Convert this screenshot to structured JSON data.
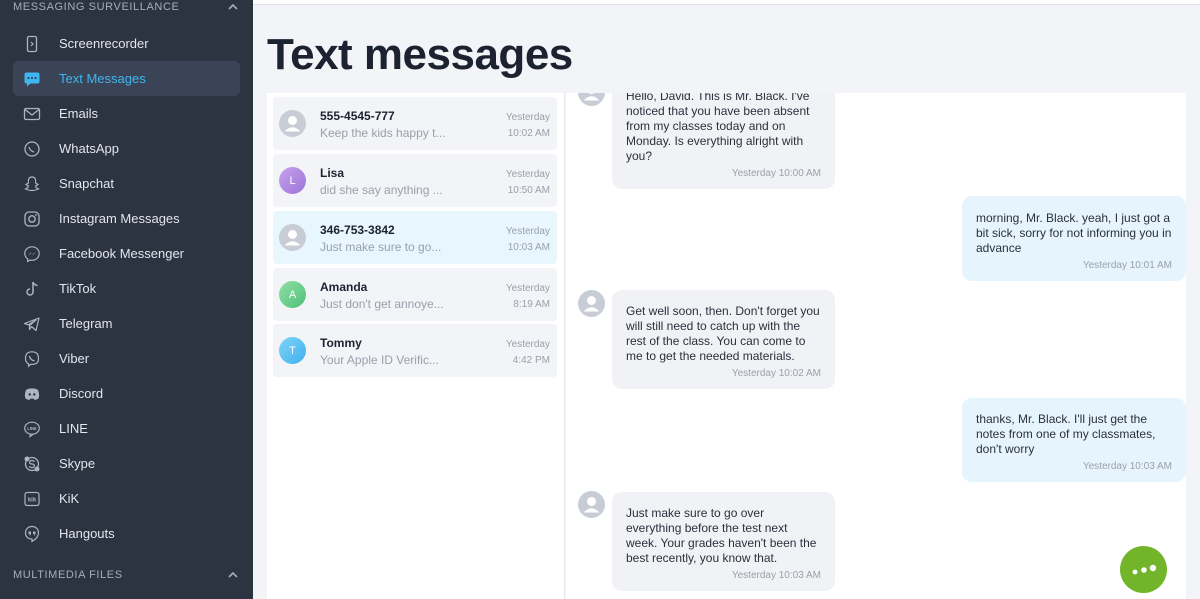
{
  "sidebar": {
    "section_messaging": "MESSAGING SURVEILLANCE",
    "section_multimedia": "MULTIMEDIA FILES",
    "items": [
      {
        "label": "Screenrecorder",
        "icon": "phone-icon"
      },
      {
        "label": "Text Messages",
        "icon": "chat-bubble-icon",
        "active": true
      },
      {
        "label": "Emails",
        "icon": "envelope-icon"
      },
      {
        "label": "WhatsApp",
        "icon": "whatsapp-icon"
      },
      {
        "label": "Snapchat",
        "icon": "snapchat-icon"
      },
      {
        "label": "Instagram Messages",
        "icon": "instagram-icon"
      },
      {
        "label": "Facebook Messenger",
        "icon": "messenger-icon"
      },
      {
        "label": "TikTok",
        "icon": "tiktok-icon"
      },
      {
        "label": "Telegram",
        "icon": "telegram-icon"
      },
      {
        "label": "Viber",
        "icon": "viber-icon"
      },
      {
        "label": "Discord",
        "icon": "discord-icon"
      },
      {
        "label": "LINE",
        "icon": "line-icon"
      },
      {
        "label": "Skype",
        "icon": "skype-icon"
      },
      {
        "label": "KiK",
        "icon": "kik-icon"
      },
      {
        "label": "Hangouts",
        "icon": "hangouts-icon"
      }
    ]
  },
  "page": {
    "title": "Text messages"
  },
  "conversations": [
    {
      "name": "555-4545-777",
      "preview": "Keep the kids happy t...",
      "day": "Yesterday",
      "time": "10:02 AM",
      "avatar": "",
      "avatar_color": "#c8ccd4"
    },
    {
      "name": "Lisa",
      "preview": "did she say anything ...",
      "day": "Yesterday",
      "time": "10:50 AM",
      "avatar": "L",
      "avatar_color": "#b48be3"
    },
    {
      "name": "346-753-3842",
      "preview": "Just make sure to go...",
      "day": "Yesterday",
      "time": "10:03 AM",
      "avatar": "",
      "avatar_color": "#c8ccd4",
      "selected": true
    },
    {
      "name": "Amanda",
      "preview": "Just don't get annoye...",
      "day": "Yesterday",
      "time": "8:19 AM",
      "avatar": "A",
      "avatar_color": "#6fd08f"
    },
    {
      "name": "Tommy",
      "preview": "Your Apple ID Verific...",
      "day": "Yesterday",
      "time": "4:42 PM",
      "avatar": "T",
      "avatar_color": "#5bc0f2"
    }
  ],
  "messages": [
    {
      "dir": "in",
      "text": "Hello, David. This is Mr. Black. I've noticed that you have been absent from my classes today and on Monday. Is everything alright with you?",
      "stamp": "Yesterday  10:00 AM"
    },
    {
      "dir": "out",
      "text": "morning, Mr. Black. yeah, I just got a bit sick, sorry for not informing you in advance",
      "stamp": "Yesterday  10:01 AM"
    },
    {
      "dir": "in",
      "text": "Get well soon, then. Don't forget you will still need to catch up with the rest of the class. You can come to me to get the needed materials.",
      "stamp": "Yesterday  10:02 AM"
    },
    {
      "dir": "out",
      "text": "thanks, Mr. Black. I'll just get the notes from one of my classmates, don't worry",
      "stamp": "Yesterday  10:03 AM"
    },
    {
      "dir": "in",
      "text": "Just make sure to go over everything before the test next week. Your grades haven't been the best recently, you know that.",
      "stamp": "Yesterday  10:03 AM"
    }
  ],
  "colors": {
    "sidebar_bg": "#2c3341",
    "accent": "#3fb6f0",
    "fab": "#72b52b"
  }
}
